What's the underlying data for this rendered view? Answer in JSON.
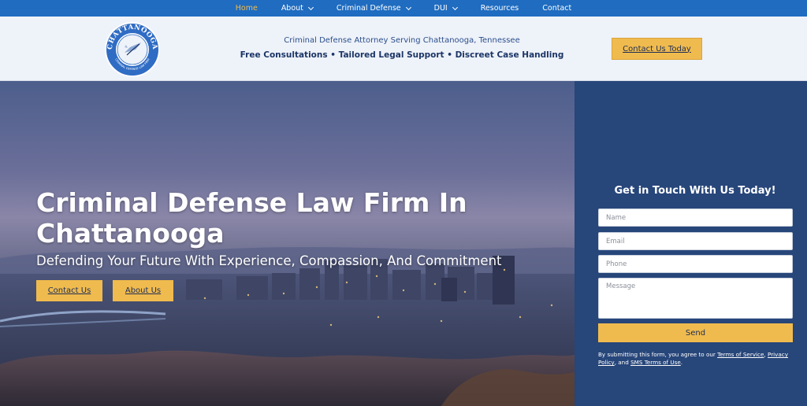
{
  "nav": {
    "items": [
      {
        "label": "Home",
        "active": true,
        "dropdown": false
      },
      {
        "label": "About",
        "active": false,
        "dropdown": true
      },
      {
        "label": "Criminal Defense",
        "active": false,
        "dropdown": true
      },
      {
        "label": "DUI",
        "active": false,
        "dropdown": true
      },
      {
        "label": "Resources",
        "active": false,
        "dropdown": false
      },
      {
        "label": "Contact",
        "active": false,
        "dropdown": false
      }
    ]
  },
  "header": {
    "logo_top_text": "CHATTANOOGA",
    "logo_bottom_text": "CRIMINAL DEFENSE LAW FIRM",
    "tagline": "Criminal Defense Attorney Serving Chattanooga, Tennessee",
    "subtagline": "Free Consultations • Tailored Legal Support • Discreet Case Handling",
    "cta_label": "Contact Us Today"
  },
  "hero": {
    "title": "Criminal Defense Law Firm In Chattanooga",
    "subtitle": "Defending Your Future With Experience, Compassion, And Commitment",
    "contact_label": "Contact Us",
    "about_label": "About Us"
  },
  "form": {
    "title": "Get in Touch With Us Today!",
    "name_placeholder": "Name",
    "email_placeholder": "Email",
    "phone_placeholder": "Phone",
    "message_placeholder": "Message",
    "send_label": "Send",
    "disclaimer_prefix": "By submitting this form, you agree to our ",
    "terms_label": "Terms of Service",
    "sep1": ", ",
    "privacy_label": "Privacy Policy",
    "sep2": ", and ",
    "sms_label": "SMS Terms of Use",
    "suffix": "."
  },
  "colors": {
    "nav_bg": "#1f6cc0",
    "nav_active": "#f0bb4e",
    "accent": "#f0bb4e",
    "header_bg": "#eef2f9",
    "panel_bg": "#27467a"
  }
}
